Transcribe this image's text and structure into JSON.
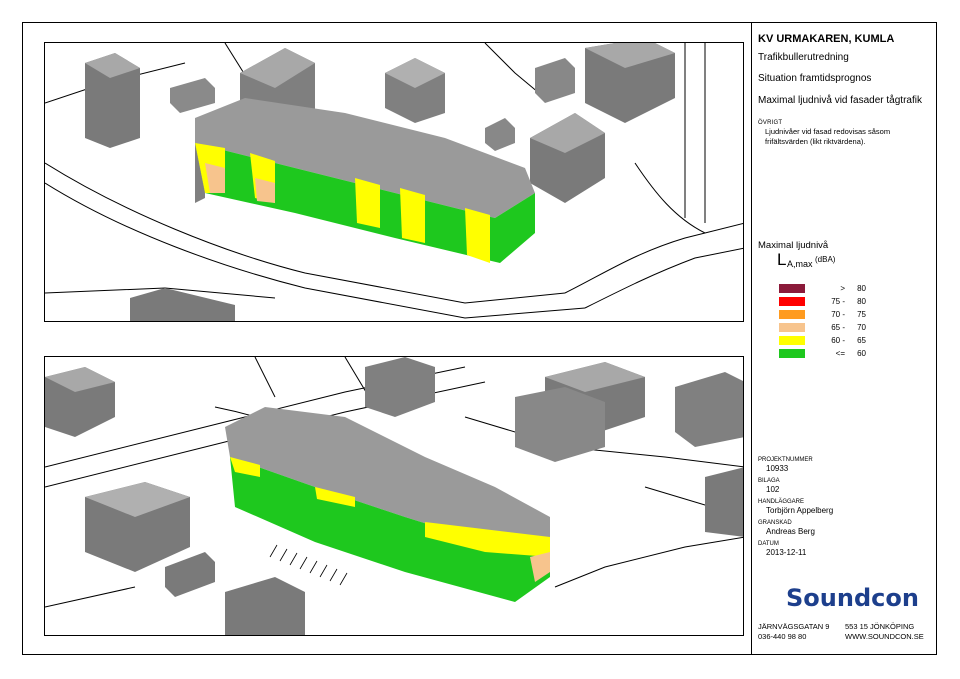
{
  "title_block": {
    "project": "KV URMAKAREN, KUMLA",
    "report": "Trafikbullerutredning",
    "situation": "Situation framtidsprognos",
    "subject": "Maximal ljudnivå vid fasader tågtrafik",
    "other_label": "ÖVRIGT",
    "other_text": "Ljudnivåer vid fasad redovisas såsom frifältsvärden (likt riktvärdena)."
  },
  "legend": {
    "title": "Maximal ljudnivå",
    "symbol": "L",
    "symbol_sub": "A,max",
    "unit": "(dBA)",
    "rows": [
      {
        "low": ">",
        "high": "80",
        "color": "#8b1a3a"
      },
      {
        "low": "75 -",
        "high": "80",
        "color": "#ff0000"
      },
      {
        "low": "70 -",
        "high": "75",
        "color": "#ff9b1f"
      },
      {
        "low": "65 -",
        "high": "70",
        "color": "#f7c48d"
      },
      {
        "low": "60 -",
        "high": "65",
        "color": "#ffff00"
      },
      {
        "low": "<=",
        "high": "60",
        "color": "#1ec81e"
      }
    ]
  },
  "info": {
    "project_number_label": "PROJEKTNUMMER",
    "project_number": "10933",
    "appendix_label": "BILAGA",
    "appendix": "102",
    "handler_label": "HANDLÄGGARE",
    "handler": "Torbjörn Appelberg",
    "reviewer_label": "GRANSKAD",
    "reviewer": "Andreas Berg",
    "date_label": "DATUM",
    "date": "2013-12-11"
  },
  "company": {
    "logo": "Soundcon",
    "street": "JÄRNVÄGSGATAN 9",
    "city": "553 15 JÖNKÖPING",
    "phone": "036-440 98 80",
    "web": "WWW.SOUNDCON.SE"
  },
  "colors": {
    "roof": "#999999",
    "wall_grey": "#808080",
    "green": "#1ec81e",
    "yellow": "#ffff00",
    "peach": "#f7c48d"
  }
}
